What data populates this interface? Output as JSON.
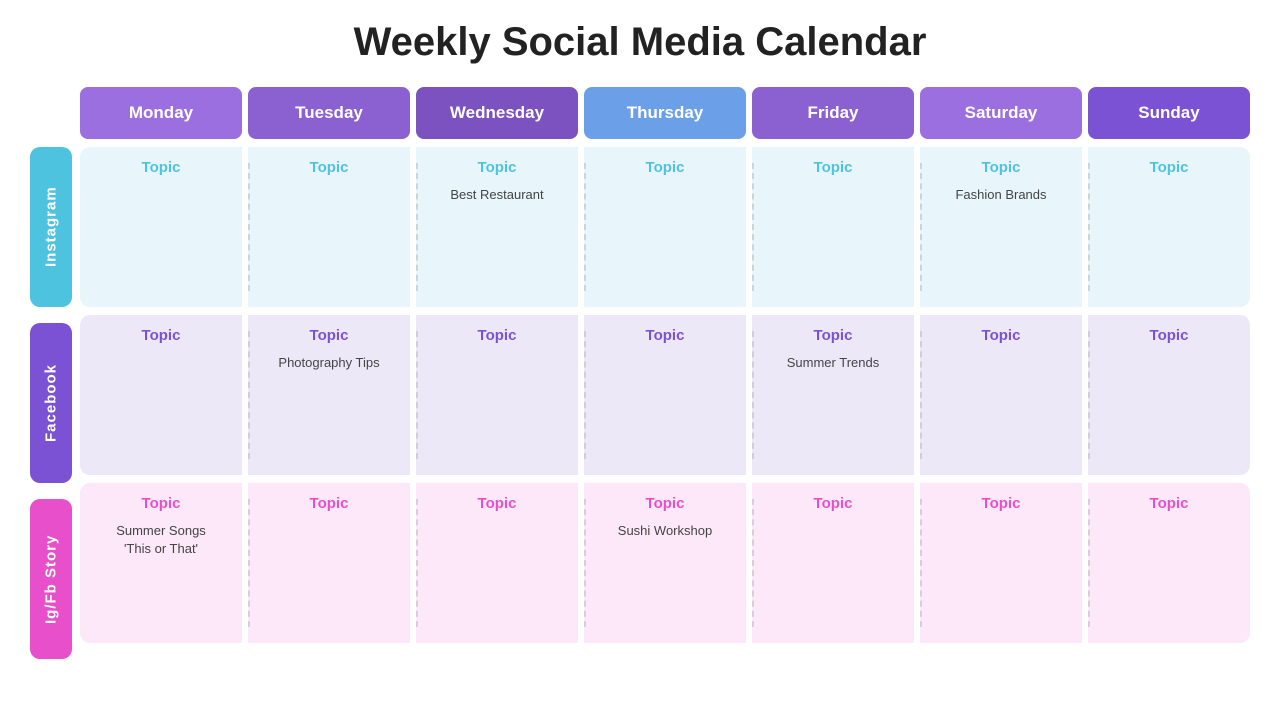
{
  "title": "Weekly Social Media Calendar",
  "days": [
    {
      "key": "monday",
      "label": "Monday"
    },
    {
      "key": "tuesday",
      "label": "Tuesday"
    },
    {
      "key": "wednesday",
      "label": "Wednesday"
    },
    {
      "key": "thursday",
      "label": "Thursday"
    },
    {
      "key": "friday",
      "label": "Friday"
    },
    {
      "key": "saturday",
      "label": "Saturday"
    },
    {
      "key": "sunday",
      "label": "Sunday"
    }
  ],
  "rows": [
    {
      "key": "instagram",
      "label": "Instagram",
      "colorClass": "instagram",
      "rowClass": "instagram-row",
      "cells": [
        {
          "topic": "Topic",
          "content": ""
        },
        {
          "topic": "Topic",
          "content": ""
        },
        {
          "topic": "Topic",
          "content": "Best Restaurant"
        },
        {
          "topic": "Topic",
          "content": ""
        },
        {
          "topic": "Topic",
          "content": ""
        },
        {
          "topic": "Topic",
          "content": "Fashion Brands"
        },
        {
          "topic": "Topic",
          "content": ""
        }
      ]
    },
    {
      "key": "facebook",
      "label": "Facebook",
      "colorClass": "facebook",
      "rowClass": "facebook-row",
      "cells": [
        {
          "topic": "Topic",
          "content": ""
        },
        {
          "topic": "Topic",
          "content": "Photography Tips"
        },
        {
          "topic": "Topic",
          "content": ""
        },
        {
          "topic": "Topic",
          "content": ""
        },
        {
          "topic": "Topic",
          "content": "Summer Trends"
        },
        {
          "topic": "Topic",
          "content": ""
        },
        {
          "topic": "Topic",
          "content": ""
        }
      ]
    },
    {
      "key": "igfb",
      "label": "Ig/Fb Story",
      "colorClass": "igfb",
      "rowClass": "igfb-row",
      "cells": [
        {
          "topic": "Topic",
          "content": "Summer Songs\n'This or That'"
        },
        {
          "topic": "Topic",
          "content": ""
        },
        {
          "topic": "Topic",
          "content": ""
        },
        {
          "topic": "Topic",
          "content": "Sushi Workshop"
        },
        {
          "topic": "Topic",
          "content": ""
        },
        {
          "topic": "Topic",
          "content": ""
        },
        {
          "topic": "Topic",
          "content": ""
        }
      ]
    }
  ]
}
